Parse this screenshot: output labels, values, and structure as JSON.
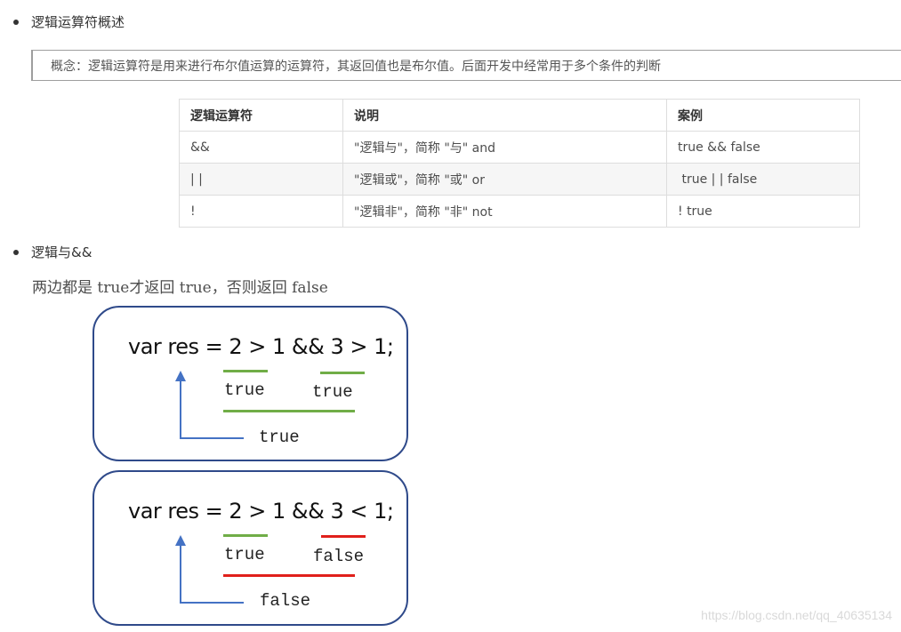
{
  "section1": {
    "title": "逻辑运算符概述"
  },
  "concept": "概念：逻辑运算符是用来进行布尔值运算的运算符，其返回值也是布尔值。后面开发中经常用于多个条件的判断",
  "table": {
    "headers": [
      "逻辑运算符",
      "说明",
      "案例"
    ],
    "rows": [
      [
        "&&",
        "\"逻辑与\"，简称 \"与\"   and",
        "true && false"
      ],
      [
        "| |",
        "\"逻辑或\"，简称 \"或\"   or",
        " true | | false"
      ],
      [
        "!",
        "\"逻辑非\"，简称 \"非\"  not",
        "! true"
      ]
    ]
  },
  "section2": {
    "title": "逻辑与&&"
  },
  "description": "两边都是 true才返回 true，否则返回 false",
  "diagram1": {
    "expression": "var res = 2 > 1 && 3 > 1;",
    "left_result": "true",
    "right_result": "true",
    "final_result": "true",
    "left_color": "#70ad47",
    "right_color": "#70ad47",
    "final_color": "#70ad47"
  },
  "diagram2": {
    "expression": "var res = 2 > 1 && 3 < 1;",
    "left_result": "true",
    "right_result": "false",
    "final_result": "false",
    "left_color": "#70ad47",
    "right_color": "#e0201b",
    "final_color": "#e0201b"
  },
  "watermark": "https://blog.csdn.net/qq_40635134"
}
